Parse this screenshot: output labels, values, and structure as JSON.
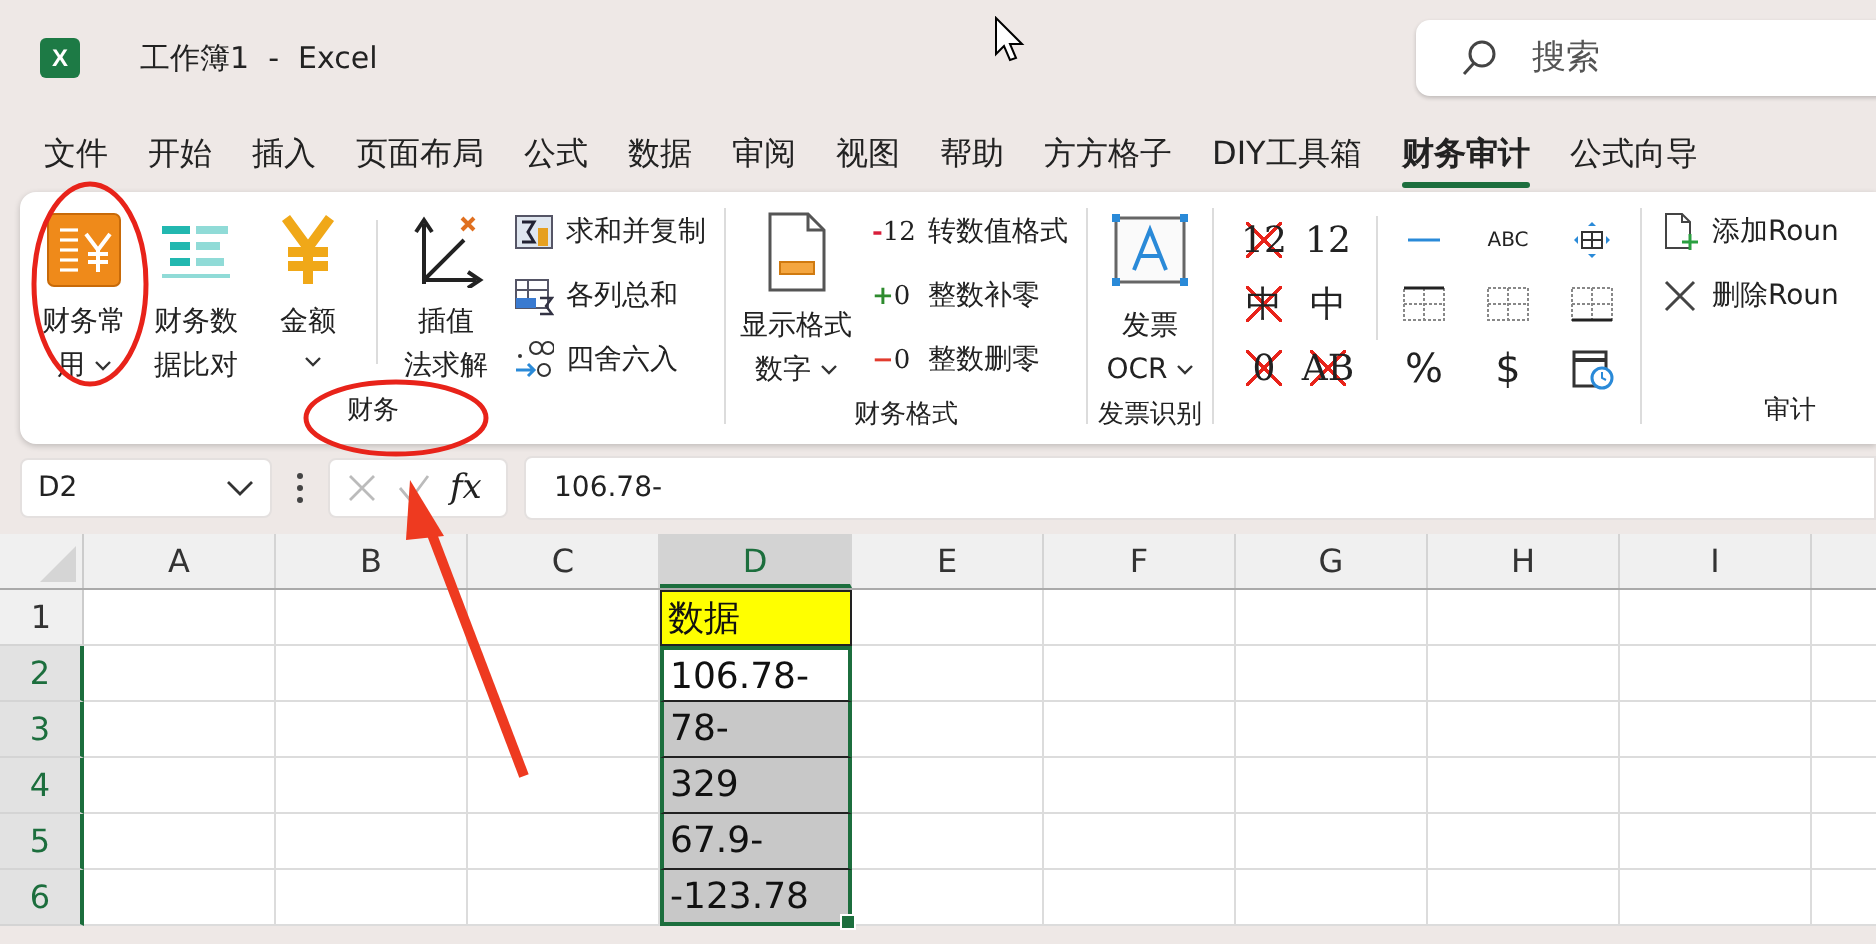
{
  "app": {
    "icon_letter": "X",
    "title": "工作簿1  -  Excel"
  },
  "search": {
    "placeholder": "搜索"
  },
  "tabs": [
    {
      "label": "文件",
      "selected": false
    },
    {
      "label": "开始",
      "selected": false
    },
    {
      "label": "插入",
      "selected": false
    },
    {
      "label": "页面布局",
      "selected": false
    },
    {
      "label": "公式",
      "selected": false
    },
    {
      "label": "数据",
      "selected": false
    },
    {
      "label": "审阅",
      "selected": false
    },
    {
      "label": "视图",
      "selected": false
    },
    {
      "label": "帮助",
      "selected": false
    },
    {
      "label": "方方格子",
      "selected": false
    },
    {
      "label": "DIY工具箱",
      "selected": false
    },
    {
      "label": "财务审计",
      "selected": true
    },
    {
      "label": "公式向导",
      "selected": false
    }
  ],
  "ribbon": {
    "finance": {
      "label": "财务",
      "large": [
        {
          "lines": [
            "财务常",
            "用"
          ],
          "dropdown": true
        },
        {
          "lines": [
            "财务数",
            "据比对"
          ],
          "dropdown": false
        },
        {
          "lines": [
            "金额"
          ],
          "dropdown": true
        },
        {
          "lines": [
            "插值",
            "法求解"
          ],
          "dropdown": false
        }
      ],
      "small": [
        "求和并复制",
        "各列总和",
        "四舍六入"
      ]
    },
    "number_format": {
      "label": "财务格式",
      "large": {
        "lines": [
          "显示格式",
          "数字"
        ],
        "dropdown": true
      },
      "small": [
        {
          "sign": "-",
          "digits": "12",
          "label": "转数值格式",
          "color": "#d81e3a"
        },
        {
          "sign": "+",
          "digits": "0",
          "label": "整数补零",
          "color": "#2e8b2e"
        },
        {
          "sign": "−",
          "digits": "0",
          "label": "整数删零",
          "color": "#e23b2e"
        }
      ]
    },
    "invoice": {
      "label": "发票识别",
      "large": {
        "lines": [
          "发票",
          "OCR"
        ],
        "dropdown": true
      }
    },
    "text_tools": {
      "marks": [
        {
          "text": "12",
          "crossed": true
        },
        {
          "text": "12",
          "crossed": false
        },
        {
          "text": "中",
          "crossed": true
        },
        {
          "text": "中",
          "crossed": false
        },
        {
          "text": "0",
          "crossed": true
        },
        {
          "text": "AB",
          "crossed": true
        }
      ],
      "symbols": [
        "ABC",
        "%",
        "$"
      ]
    },
    "audit": {
      "label": "审计",
      "small": [
        "添加Roun",
        "删除Roun"
      ]
    }
  },
  "formula_bar": {
    "name_box": "D2",
    "fx": "fx",
    "value": "106.78-"
  },
  "sheet": {
    "columns": [
      {
        "label": "A",
        "selected": false
      },
      {
        "label": "B",
        "selected": false
      },
      {
        "label": "C",
        "selected": false
      },
      {
        "label": "D",
        "selected": true,
        "values": [
          {
            "text": "数据",
            "highlight": true,
            "selected": false,
            "active": false
          },
          {
            "text": "106.78-",
            "highlight": false,
            "selected": true,
            "active": true
          },
          {
            "text": "78-",
            "highlight": false,
            "selected": true,
            "active": false
          },
          {
            "text": "329",
            "highlight": false,
            "selected": true,
            "active": false
          },
          {
            "text": "67.9-",
            "highlight": false,
            "selected": true,
            "active": false
          },
          {
            "text": "-123.78",
            "highlight": false,
            "selected": true,
            "active": false
          }
        ]
      },
      {
        "label": "E",
        "selected": false
      },
      {
        "label": "F",
        "selected": false
      },
      {
        "label": "G",
        "selected": false
      },
      {
        "label": "H",
        "selected": false
      },
      {
        "label": "I",
        "selected": false
      }
    ],
    "rows": [
      {
        "label": "1",
        "selected": false
      },
      {
        "label": "2",
        "selected": true
      },
      {
        "label": "3",
        "selected": true
      },
      {
        "label": "4",
        "selected": true
      },
      {
        "label": "5",
        "selected": true
      },
      {
        "label": "6",
        "selected": true
      }
    ]
  }
}
